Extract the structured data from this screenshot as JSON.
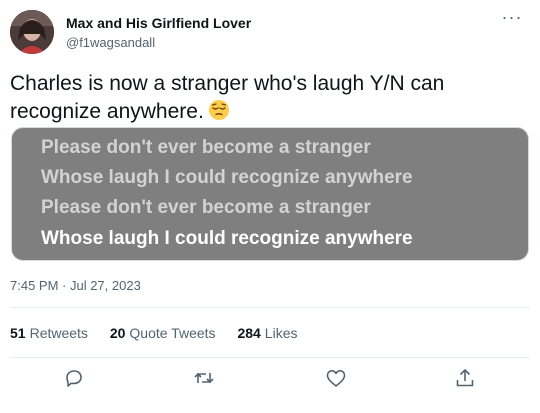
{
  "author": {
    "display_name": "Max and His Girlfiend Lover",
    "handle": "@f1wagsandall",
    "avatar_icon": "avatar-photo"
  },
  "more_icon": "more-options-icon",
  "tweet": {
    "text": "Charles is now a stranger who's laugh Y/N can recognize anywhere.",
    "emoji": "pensive-face-emoji",
    "timestamp": "7:45 PM · Jul 27, 2023"
  },
  "media": {
    "background": "#7f7f7f",
    "lines": [
      "Please don't ever become a stranger",
      "Whose laugh I could recognize anywhere",
      "Please don't ever become a stranger",
      "Whose laugh I could recognize anywhere"
    ]
  },
  "stats": {
    "retweets": {
      "count": "51",
      "label": "Retweets"
    },
    "quotes": {
      "count": "20",
      "label": "Quote Tweets"
    },
    "likes": {
      "count": "284",
      "label": "Likes"
    }
  },
  "actions": [
    "reply-icon",
    "retweet-icon",
    "like-icon",
    "share-icon"
  ]
}
